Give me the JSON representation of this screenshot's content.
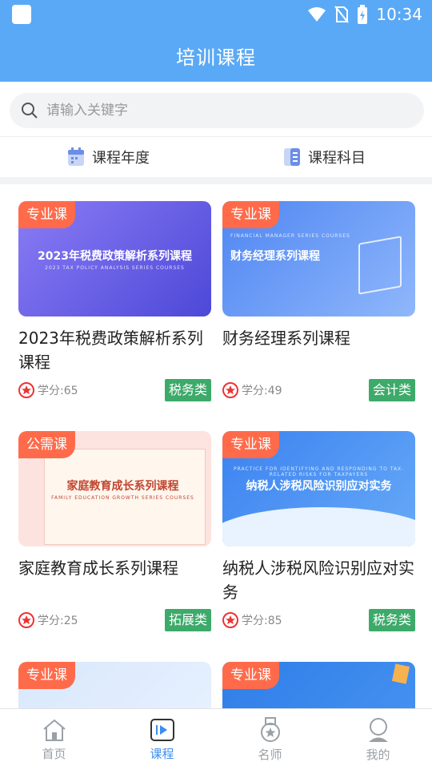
{
  "status": {
    "time": "10:34"
  },
  "header": {
    "title": "培训课程"
  },
  "search": {
    "placeholder": "请输入关键字"
  },
  "filters": [
    {
      "label": "课程年度",
      "icon": "calendar-icon"
    },
    {
      "label": "课程科目",
      "icon": "list-icon"
    }
  ],
  "courses": [
    {
      "badge": "专业课",
      "thumb_title": "2023年税费政策解析系列课程",
      "thumb_sub": "2023 TAX POLICY ANALYSIS SERIES COURSES",
      "title": "2023年税费政策解析系列课程",
      "credit": "学分:65",
      "tag": "税务类"
    },
    {
      "badge": "专业课",
      "thumb_title": "财务经理系列课程",
      "thumb_sub": "FINANCIAL MANAGER SERIES COURSES",
      "title": "财务经理系列课程",
      "credit": "学分:49",
      "tag": "会计类"
    },
    {
      "badge": "公需课",
      "thumb_title": "家庭教育成长系列课程",
      "thumb_sub": "FAMILY EDUCATION GROWTH SERIES COURSES",
      "title": "家庭教育成长系列课程",
      "credit": "学分:25",
      "tag": "拓展类"
    },
    {
      "badge": "专业课",
      "thumb_title": "纳税人涉税风险识别应对实务",
      "thumb_sub": "PRACTICE FOR IDENTIFYING AND RESPONDING TO TAX-RELATED RISKS FOR TAXPAYERS",
      "title": "纳税人涉税风险识别应对实务",
      "credit": "学分:85",
      "tag": "税务类"
    },
    {
      "badge": "专业课"
    },
    {
      "badge": "专业课"
    }
  ],
  "tabs": [
    {
      "label": "首页",
      "icon": "home-icon"
    },
    {
      "label": "课程",
      "icon": "play-icon"
    },
    {
      "label": "名师",
      "icon": "medal-icon"
    },
    {
      "label": "我的",
      "icon": "user-icon"
    }
  ],
  "colors": {
    "primary": "#5aa9f6",
    "badge": "#ff6b4a",
    "tag": "#3daa6a",
    "tab_active": "#3c8ef0"
  }
}
